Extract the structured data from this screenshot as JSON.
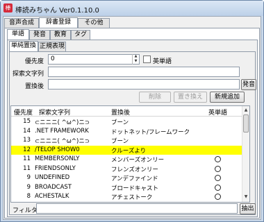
{
  "window": {
    "title": "棒読みちゃん Ver0.1.10.0",
    "icon": "app-icon"
  },
  "top_tabs": [
    "音声合成",
    "辞書登録",
    "その他"
  ],
  "sub_tabs": [
    "単語",
    "発音",
    "教育",
    "タグ"
  ],
  "inner_tabs": [
    "単純置換",
    "正規表現"
  ],
  "form": {
    "priority_label": "優先度",
    "priority_value": "0",
    "english_label": "英単語",
    "search_label": "探索文字列",
    "search_value": "",
    "replace_label": "置換後",
    "replace_value": "",
    "pronounce_button": "発音",
    "delete_button": "削除",
    "overwrite_button": "置き換え",
    "add_button": "新規追加"
  },
  "table": {
    "headers": [
      "優先度",
      "探索文字列",
      "置換後",
      "英単語"
    ],
    "rows": [
      {
        "priority": "15",
        "search": "⊂ニニニ( ^ω^)ニ⊃",
        "replace": "ブーン",
        "english": false,
        "highlight": false
      },
      {
        "priority": "14",
        "search": ".NET FRAMEWORK",
        "replace": "ドットネット/フレームワーク",
        "english": false,
        "highlight": false
      },
      {
        "priority": "13",
        "search": "⊂ニニニ( ^ω^)ニ⊃",
        "replace": "ブーン",
        "english": false,
        "highlight": false
      },
      {
        "priority": "12",
        "search": "/TELOP SHOW0",
        "replace": "クルーズより",
        "english": false,
        "highlight": true
      },
      {
        "priority": "11",
        "search": "MEMBERSONLY",
        "replace": "メンバーズオンリー",
        "english": true,
        "highlight": false
      },
      {
        "priority": "11",
        "search": "FRIENDSONLY",
        "replace": "フレンズオンリー",
        "english": true,
        "highlight": false
      },
      {
        "priority": "9",
        "search": "UNDEFINED",
        "replace": "アンデファインド",
        "english": true,
        "highlight": false
      },
      {
        "priority": "9",
        "search": "BROADCAST",
        "replace": "ブロードキャスト",
        "english": true,
        "highlight": false
      },
      {
        "priority": "8",
        "search": "ACHESTALK",
        "replace": "アチェストーク",
        "english": true,
        "highlight": false
      }
    ]
  },
  "filter": {
    "label": "フィルタ",
    "value": "",
    "button": "抽出"
  },
  "colors": {
    "highlight": "#ffff00",
    "window_frame": "#c9d8ea",
    "app_icon": "#d52b3c"
  }
}
